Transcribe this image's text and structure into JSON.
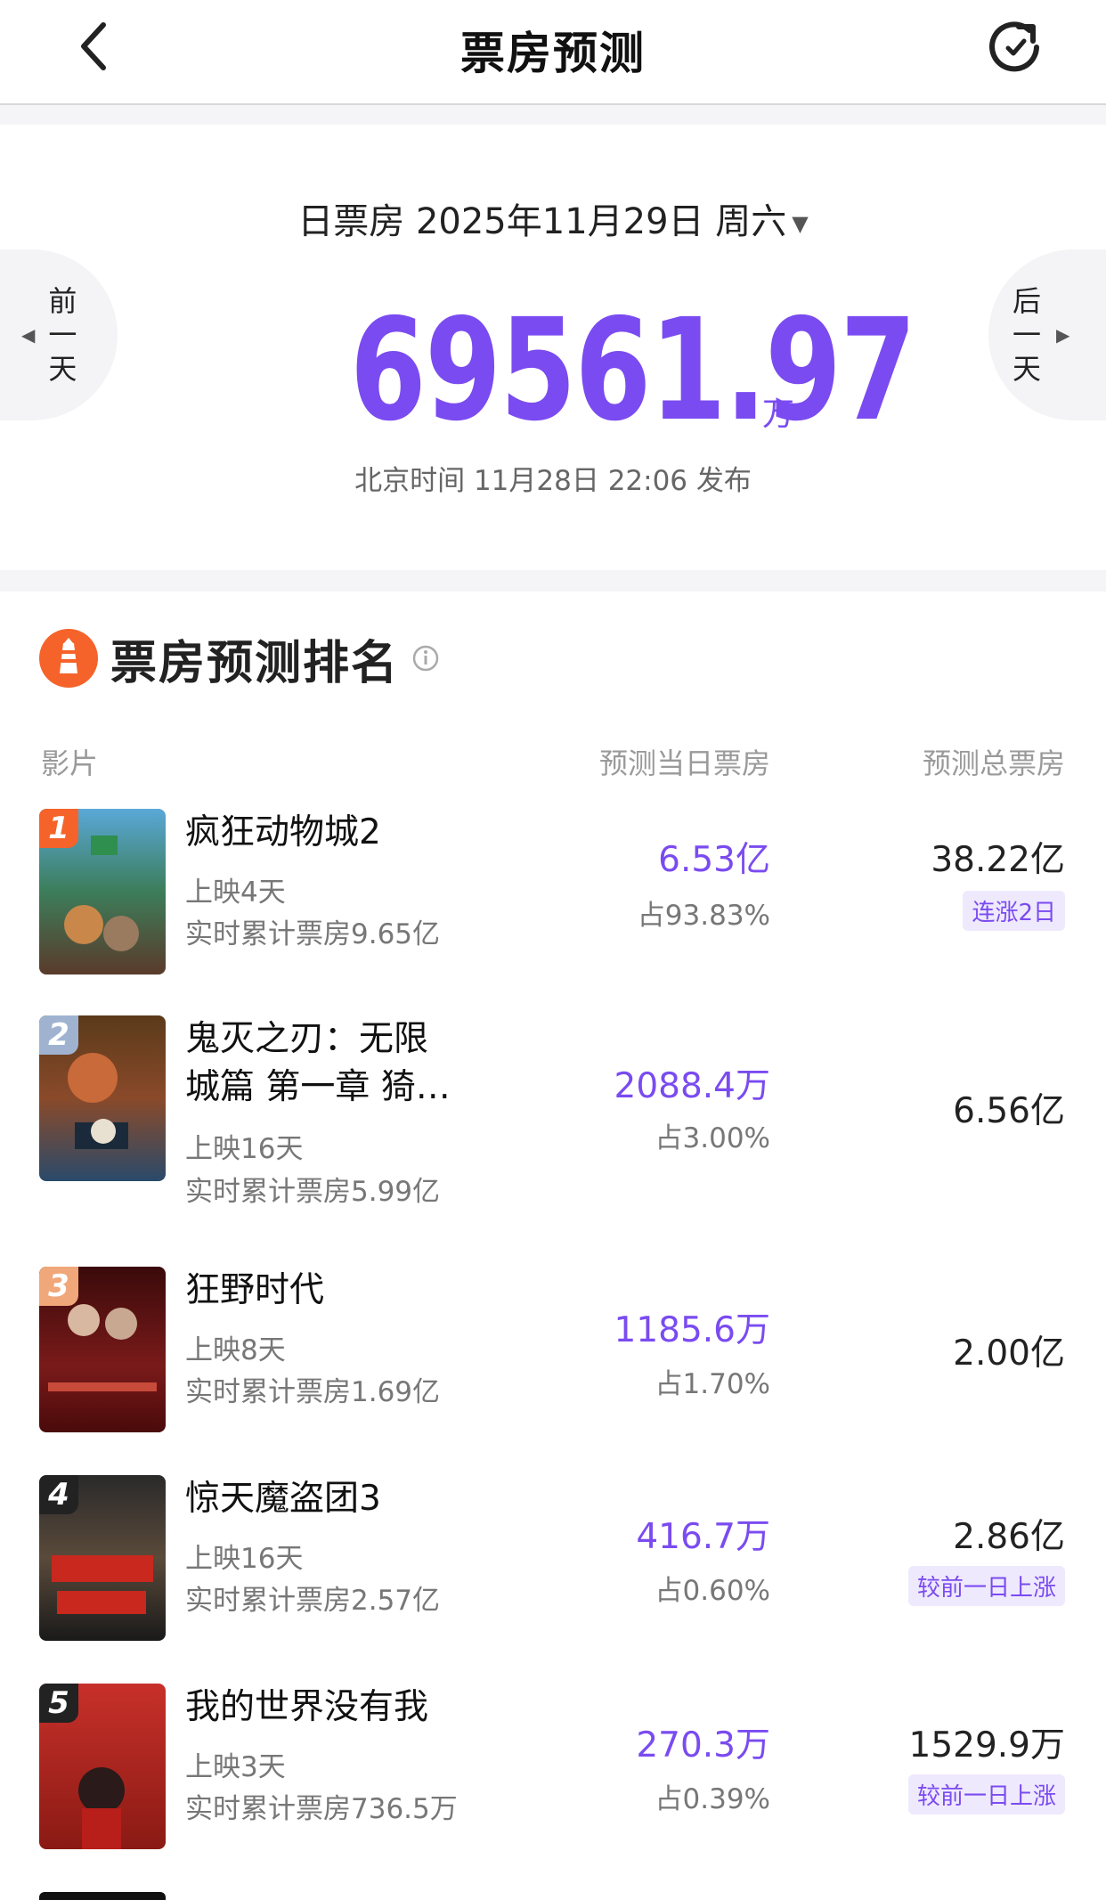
{
  "header": {
    "title": "票房预测"
  },
  "hero": {
    "date_label": "日票房 2025年11月29日 周六",
    "prev_label": "前一天",
    "next_label": "后一天",
    "prev_chars": [
      "前",
      "一",
      "天"
    ],
    "next_chars": [
      "后",
      "一",
      "天"
    ],
    "total_value": "69561.97",
    "total_unit": "万",
    "publish_note": "北京时间 11月28日 22:06 发布"
  },
  "ranking": {
    "title": "票房预测排名",
    "columns": {
      "film": "影片",
      "day": "预测当日票房",
      "total": "预测总票房"
    },
    "rows": [
      {
        "rank": "1",
        "name_line1": "疯狂动物城2",
        "name_line2": "",
        "days": "上映4天",
        "cumulative": "实时累计票房9.65亿",
        "day_value": "6.53亿",
        "share": "占93.83%",
        "total": "38.22亿",
        "tag": "连涨2日",
        "badge_color": "#f5632a"
      },
      {
        "rank": "2",
        "name_line1": "鬼灭之刃：无限",
        "name_line2": "城篇 第一章 猗…",
        "days": "上映16天",
        "cumulative": "实时累计票房5.99亿",
        "day_value": "2088.4万",
        "share": "占3.00%",
        "total": "6.56亿",
        "tag": "",
        "badge_color": "#9fb3d1"
      },
      {
        "rank": "3",
        "name_line1": "狂野时代",
        "name_line2": "",
        "days": "上映8天",
        "cumulative": "实时累计票房1.69亿",
        "day_value": "1185.6万",
        "share": "占1.70%",
        "total": "2.00亿",
        "tag": "",
        "badge_color": "#f0a77a"
      },
      {
        "rank": "4",
        "name_line1": "惊天魔盗团3",
        "name_line2": "",
        "days": "上映16天",
        "cumulative": "实时累计票房2.57亿",
        "day_value": "416.7万",
        "share": "占0.60%",
        "total": "2.86亿",
        "tag": "较前一日上涨",
        "badge_color": "#222222"
      },
      {
        "rank": "5",
        "name_line1": "我的世界没有我",
        "name_line2": "",
        "days": "上映3天",
        "cumulative": "实时累计票房736.5万",
        "day_value": "270.3万",
        "share": "占0.39%",
        "total": "1529.9万",
        "tag": "较前一日上涨",
        "badge_color": "#222222"
      }
    ]
  },
  "icons": {
    "back": "chevron-left-icon",
    "refresh": "refresh-icon",
    "ranking_logo": "lighthouse-icon",
    "info": "info-icon"
  },
  "colors": {
    "accent": "#7a4bf0",
    "logo": "#f5632a"
  }
}
